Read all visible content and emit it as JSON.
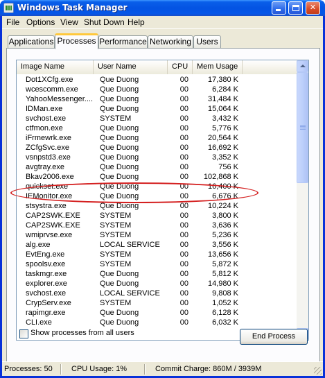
{
  "window": {
    "title": "Windows Task Manager",
    "controls": {
      "minimize": "minimize",
      "maximize": "maximize",
      "close": "✕"
    }
  },
  "menu": [
    "File",
    "Options",
    "View",
    "Shut Down",
    "Help"
  ],
  "tabs": [
    "Applications",
    "Processes",
    "Performance",
    "Networking",
    "Users"
  ],
  "active_tab": "Processes",
  "columns": [
    "Image Name",
    "User Name",
    "CPU",
    "Mem Usage"
  ],
  "processes": [
    {
      "name": "Dot1XCfg.exe",
      "user": "Que Duong",
      "cpu": "00",
      "mem": "17,380 K"
    },
    {
      "name": "wcescomm.exe",
      "user": "Que Duong",
      "cpu": "00",
      "mem": "6,284 K"
    },
    {
      "name": "YahooMessenger....",
      "user": "Que Duong",
      "cpu": "00",
      "mem": "31,484 K"
    },
    {
      "name": "IDMan.exe",
      "user": "Que Duong",
      "cpu": "00",
      "mem": "15,064 K"
    },
    {
      "name": "svchost.exe",
      "user": "SYSTEM",
      "cpu": "00",
      "mem": "3,432 K"
    },
    {
      "name": "ctfmon.exe",
      "user": "Que Duong",
      "cpu": "00",
      "mem": "5,776 K"
    },
    {
      "name": "iFrmewrk.exe",
      "user": "Que Duong",
      "cpu": "00",
      "mem": "20,564 K"
    },
    {
      "name": "ZCfgSvc.exe",
      "user": "Que Duong",
      "cpu": "00",
      "mem": "16,692 K"
    },
    {
      "name": "vsnpstd3.exe",
      "user": "Que Duong",
      "cpu": "00",
      "mem": "3,352 K"
    },
    {
      "name": "avgtray.exe",
      "user": "Que Duong",
      "cpu": "00",
      "mem": "756 K"
    },
    {
      "name": "Bkav2006.exe",
      "user": "Que Duong",
      "cpu": "00",
      "mem": "102,868 K"
    },
    {
      "name": "quickset.exe",
      "user": "Que Duong",
      "cpu": "00",
      "mem": "16,400 K"
    },
    {
      "name": "IEMonitor.exe",
      "user": "Que Duong",
      "cpu": "00",
      "mem": "6,676 K"
    },
    {
      "name": "stsystra.exe",
      "user": "Que Duong",
      "cpu": "00",
      "mem": "10,224 K"
    },
    {
      "name": "CAP2SWK.EXE",
      "user": "SYSTEM",
      "cpu": "00",
      "mem": "3,800 K"
    },
    {
      "name": "CAP2SWK.EXE",
      "user": "SYSTEM",
      "cpu": "00",
      "mem": "3,636 K"
    },
    {
      "name": "wmiprvse.exe",
      "user": "SYSTEM",
      "cpu": "00",
      "mem": "5,236 K"
    },
    {
      "name": "alg.exe",
      "user": "LOCAL SERVICE",
      "cpu": "00",
      "mem": "3,556 K"
    },
    {
      "name": "EvtEng.exe",
      "user": "SYSTEM",
      "cpu": "00",
      "mem": "13,656 K"
    },
    {
      "name": "spoolsv.exe",
      "user": "SYSTEM",
      "cpu": "00",
      "mem": "5,872 K"
    },
    {
      "name": "taskmgr.exe",
      "user": "Que Duong",
      "cpu": "00",
      "mem": "5,812 K"
    },
    {
      "name": "explorer.exe",
      "user": "Que Duong",
      "cpu": "00",
      "mem": "14,980 K"
    },
    {
      "name": "svchost.exe",
      "user": "LOCAL SERVICE",
      "cpu": "00",
      "mem": "9,808 K"
    },
    {
      "name": "CrypServ.exe",
      "user": "SYSTEM",
      "cpu": "00",
      "mem": "1,052 K"
    },
    {
      "name": "rapimgr.exe",
      "user": "Que Duong",
      "cpu": "00",
      "mem": "6,128 K"
    },
    {
      "name": "CLI.exe",
      "user": "Que Duong",
      "cpu": "00",
      "mem": "6,032 K"
    }
  ],
  "highlighted_process": "Bkav2006.exe",
  "show_all_users": {
    "label": "Show processes from all users",
    "checked": false
  },
  "end_process_label": "End Process",
  "status": {
    "processes": "Processes: 50",
    "cpu": "CPU Usage: 1%",
    "commit": "Commit Charge: 860M / 3939M"
  },
  "colors": {
    "titlebar": "#0453e2",
    "annotation": "#d42020",
    "face": "#ece9d8"
  }
}
